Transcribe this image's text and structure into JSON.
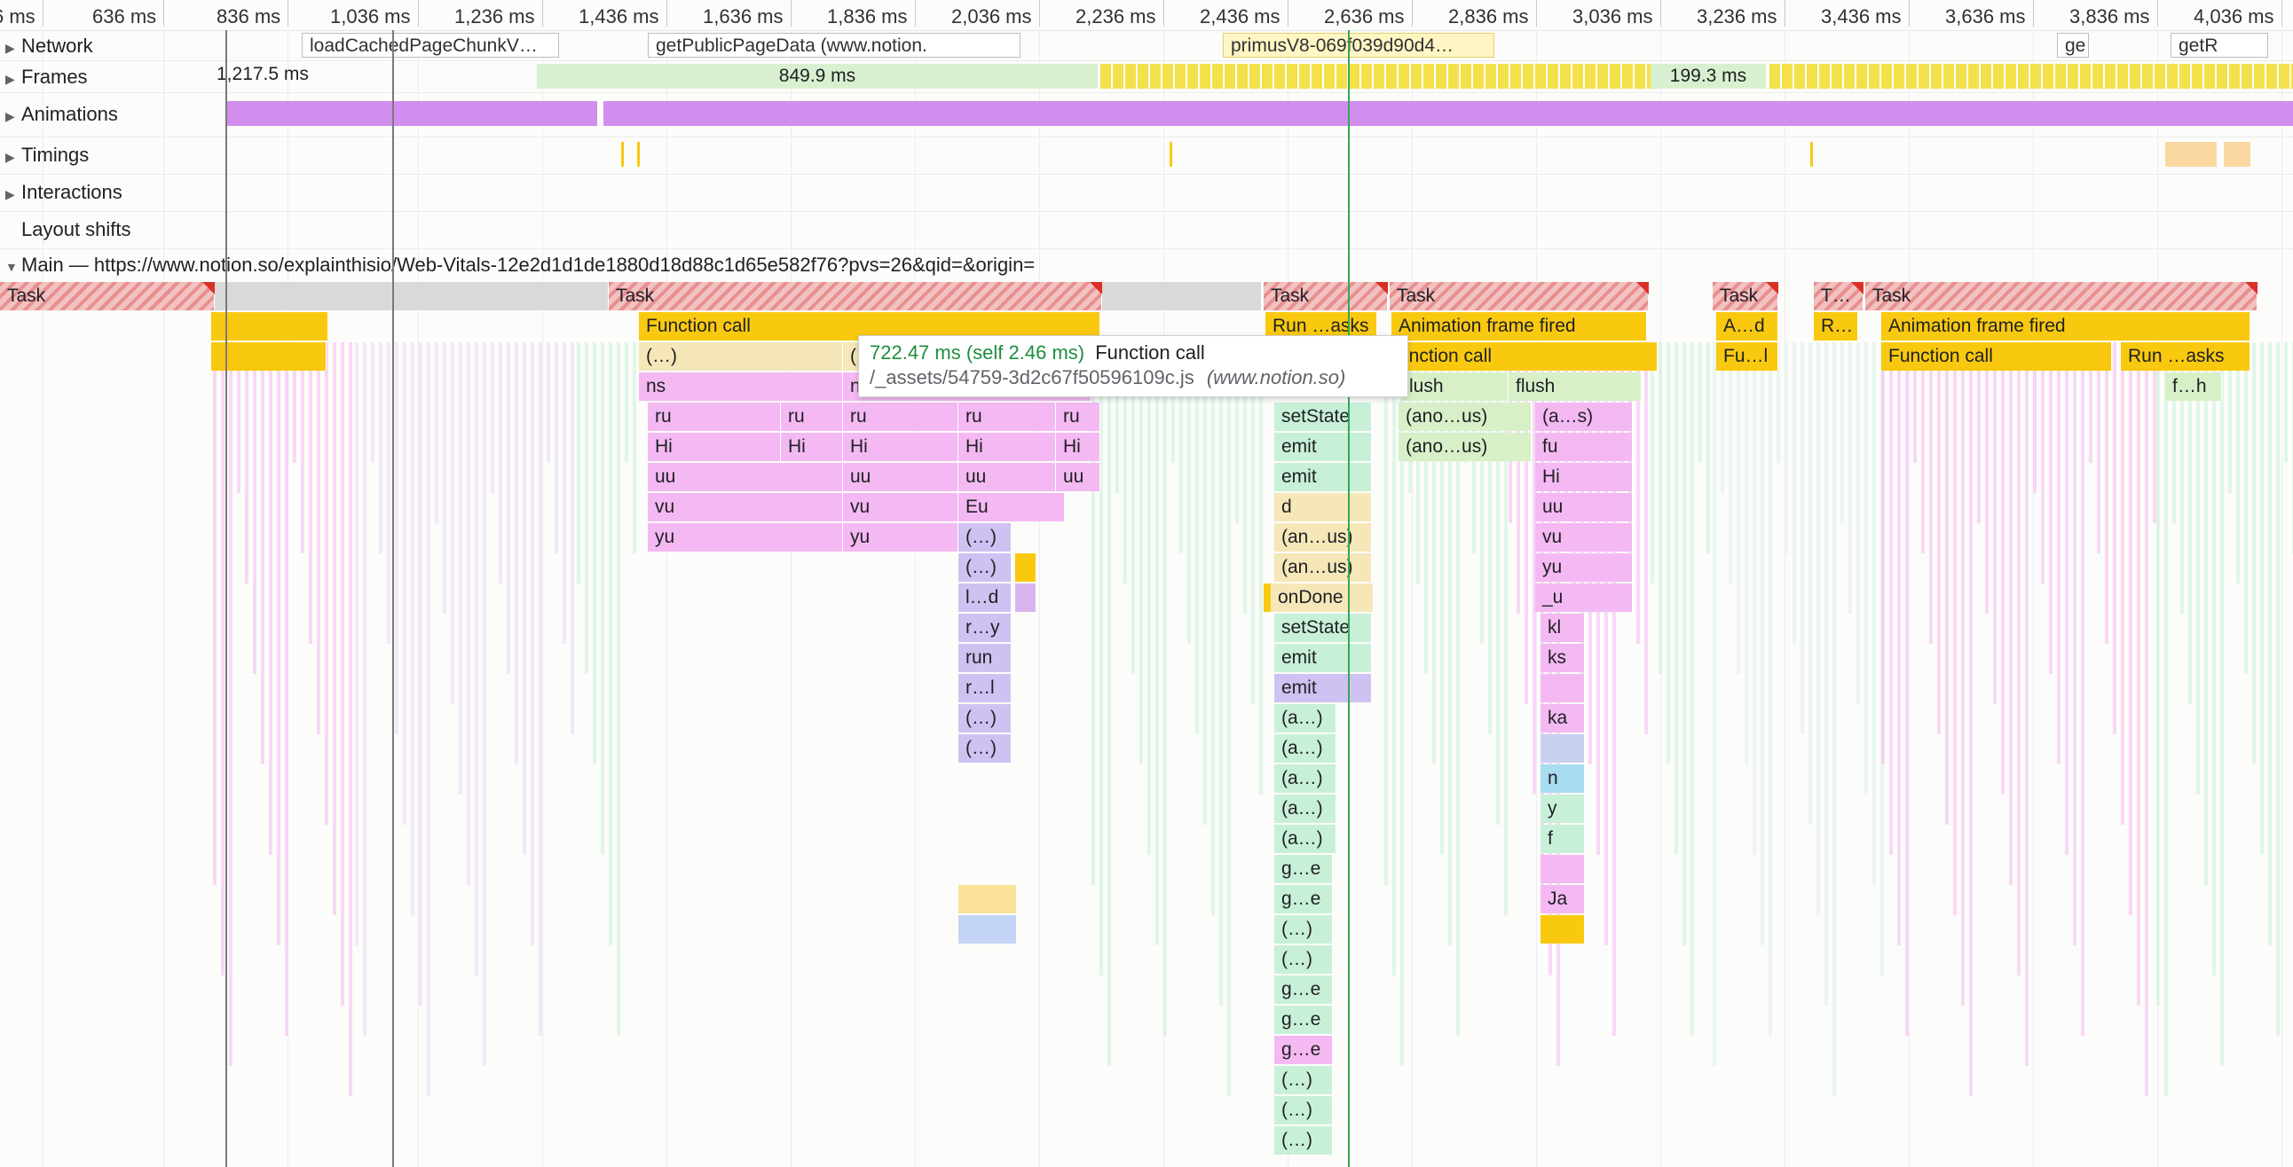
{
  "ruler": {
    "ticks": [
      "6 ms",
      "636 ms",
      "836 ms",
      "1,036 ms",
      "1,236 ms",
      "1,436 ms",
      "1,636 ms",
      "1,836 ms",
      "2,036 ms",
      "2,236 ms",
      "2,436 ms",
      "2,636 ms",
      "2,836 ms",
      "3,036 ms",
      "3,236 ms",
      "3,436 ms",
      "3,636 ms",
      "3,836 ms",
      "4,036 ms"
    ]
  },
  "tracks": {
    "network": "Network",
    "frames": "Frames",
    "animations": "Animations",
    "timings": "Timings",
    "interactions": "Interactions",
    "layout_shifts": "Layout shifts",
    "main": "Main — https://www.notion.so/explainthisio/Web-Vitals-12e2d1d1de1880d18d88c1d65e582f76?pvs=26&qid=&origin="
  },
  "network_bars": [
    "loadCachedPageChunkV…",
    "getPublicPageData (www.notion.",
    "primusV8-069f039d90d4…",
    "ge",
    "getR"
  ],
  "frame_labels": [
    "1,217.5 ms",
    "849.9 ms",
    "199.3 ms"
  ],
  "tooltip": {
    "duration": "722.47 ms (self 2.46 ms)",
    "name": "Function call",
    "url": "/_assets/54759-3d2c67f50596109c.js",
    "origin": "(www.notion.so)"
  },
  "flame": {
    "row0": [
      "Task",
      "Task",
      "Task",
      "Task",
      "Task",
      "T…",
      "Task"
    ],
    "row1": [
      "Function call",
      "Run …asks",
      "Animation frame fired",
      "A…d",
      "R…",
      "Animation frame fired"
    ],
    "row2": [
      "(…)",
      "(",
      "unction call",
      "Fu…l",
      "Function call",
      "Run …asks"
    ],
    "row3": [
      "ns",
      "n",
      "lush",
      "flush",
      "f…h"
    ],
    "row4": [
      "ru",
      "ru",
      "ru",
      "ru",
      "ru",
      "setState",
      "(ano…us)",
      "(a…s)"
    ],
    "row5": [
      "Hi",
      "Hi",
      "Hi",
      "Hi",
      "Hi",
      "emit",
      "(ano…us)",
      "fu"
    ],
    "row6": [
      "uu",
      "uu",
      "uu",
      "uu",
      "emit",
      "Hi"
    ],
    "row7": [
      "vu",
      "vu",
      "Eu",
      "d",
      "uu"
    ],
    "row8": [
      "yu",
      "yu",
      "(…)",
      "(an…us)",
      "vu"
    ],
    "row9": [
      "(…)",
      "(an…us)",
      "yu"
    ],
    "row10": [
      "l…d",
      "onDone",
      "_u"
    ],
    "row11": [
      "r…y",
      "setState",
      "kl"
    ],
    "row12": [
      "run",
      "emit",
      "ks"
    ],
    "row13": [
      "r…l",
      "emit"
    ],
    "row14": [
      "(…)",
      "(a…)",
      "ka"
    ],
    "row15": [
      "(…)",
      "(a…)"
    ],
    "row16": [
      "(a…)",
      "n"
    ],
    "row17": [
      "(a…)",
      "y"
    ],
    "row18": [
      "(a…)",
      "f"
    ],
    "row19": [
      "g…e"
    ],
    "row20": [
      "g…e",
      "Ja"
    ],
    "row21": [
      "(…)"
    ],
    "row22": [
      "(…)"
    ],
    "row23": [
      "g…e"
    ],
    "row24": [
      "g…e"
    ],
    "row25": [
      "g…e"
    ],
    "row26": [
      "(…)"
    ],
    "row27": [
      "(…)"
    ],
    "row28": [
      "(…)"
    ]
  },
  "colors": {
    "task": "#f2c2c2",
    "task_hatch": "#e88f8f",
    "yellow": "#f9c90f",
    "pink": "#f4b9f2",
    "green": "#c8f0d8",
    "purple": "#d7b4f0",
    "lavender": "#cfc2f2",
    "animation": "#d28eef",
    "frame_green": "#d8f0d0",
    "frame_yellow": "#f4e04a",
    "tooltip_green": "#1e8e3e",
    "cursor_green": "#34a853"
  }
}
